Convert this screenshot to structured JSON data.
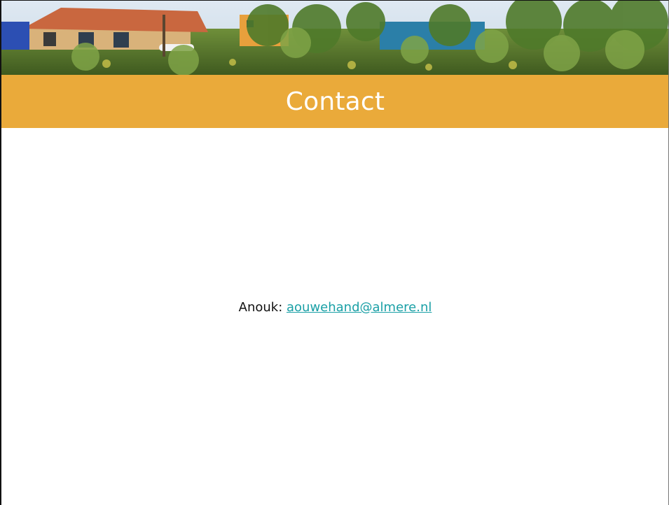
{
  "slide": {
    "title": "Contact",
    "contact": {
      "name_label": "Anouk:",
      "email": "aouwehand@almere.nl"
    }
  },
  "colors": {
    "title_band": "#eaaa3a",
    "title_text": "#ffffff",
    "link": "#1aa0a6"
  }
}
